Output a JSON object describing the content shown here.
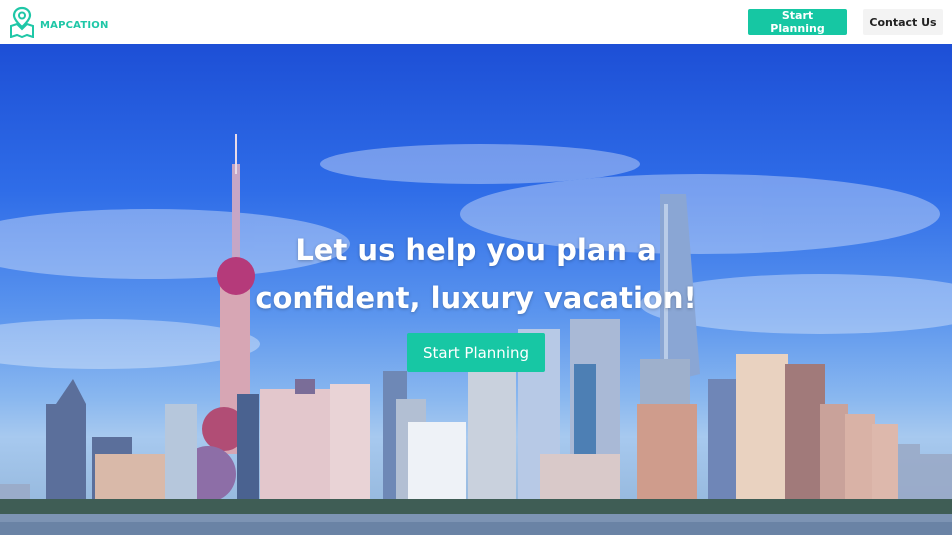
{
  "brand": {
    "name": "MAPCATION",
    "logo_icon": "map-pin-icon",
    "accent_color": "#16c7a3"
  },
  "nav": {
    "start_planning_label": "Start Planning",
    "contact_label": "Contact Us"
  },
  "hero": {
    "title_line1": "Let us help you plan a",
    "title_line2": "confident, luxury vacation!",
    "cta_label": "Start Planning",
    "background": "city-skyline-photo"
  }
}
